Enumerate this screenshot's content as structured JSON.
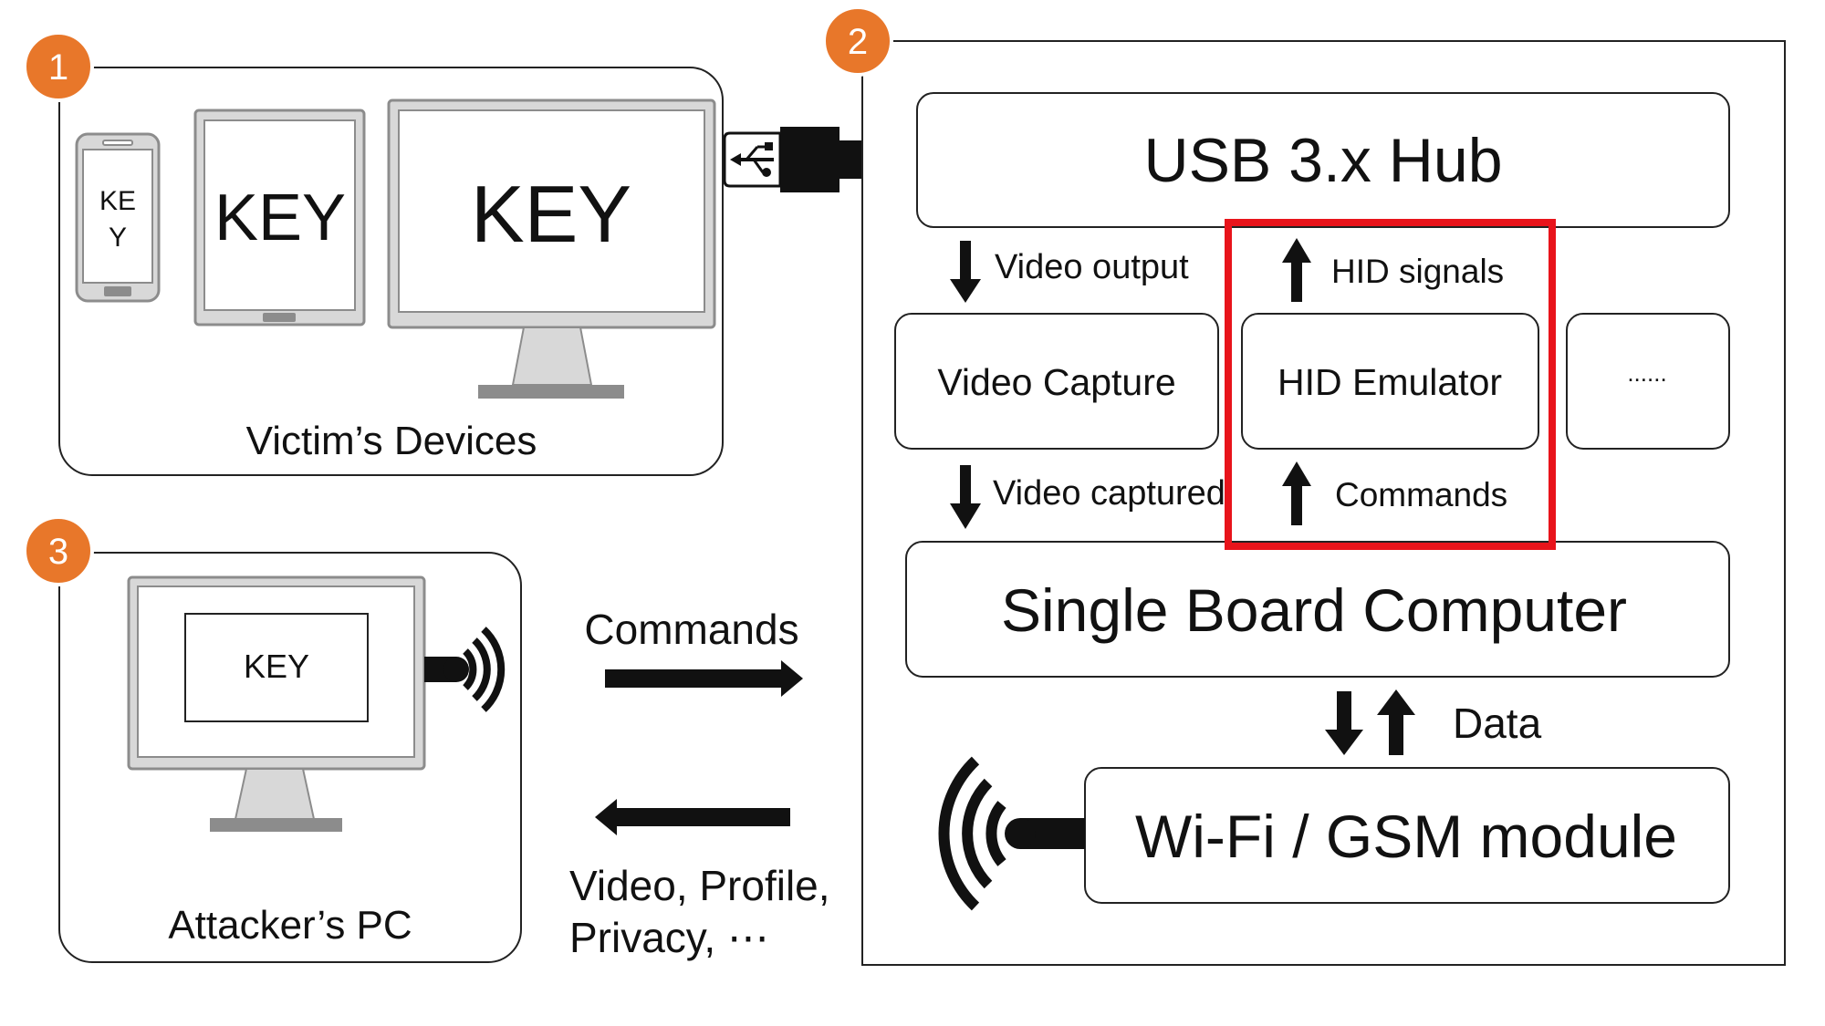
{
  "colors": {
    "badge": "#E8772A",
    "highlight": "#E8141B",
    "device_fill": "#D8D8D8",
    "device_stroke": "#8C8C8C",
    "line": "#222222"
  },
  "badges": [
    "1",
    "2",
    "3"
  ],
  "victim": {
    "label": "Victim’s Devices",
    "phone_text_line1": "KE",
    "phone_text_line2": "Y",
    "tablet_text": "KEY",
    "monitor_text": "KEY"
  },
  "attacker": {
    "label": "Attacker’s PC",
    "screen_text": "KEY"
  },
  "device": {
    "usb_hub": "USB 3.x Hub",
    "video_output": "Video output",
    "hid_signals": "HID signals",
    "video_capture": "Video Capture",
    "hid_emulator": "HID Emulator",
    "ellipsis": "......",
    "video_captured": "Video captured",
    "commands_inner": "Commands",
    "sbc": "Single Board Computer",
    "data": "Data",
    "wifi_module": "Wi-Fi / GSM module"
  },
  "flows": {
    "commands": "Commands",
    "return_line1": "Video, Profile,",
    "return_line2": "Privacy, ⋯"
  },
  "icons": {
    "usb_plug": "usb-plug-icon",
    "wifi_waves": "wifi-waves-icon",
    "antenna": "antenna-signal-icon"
  }
}
